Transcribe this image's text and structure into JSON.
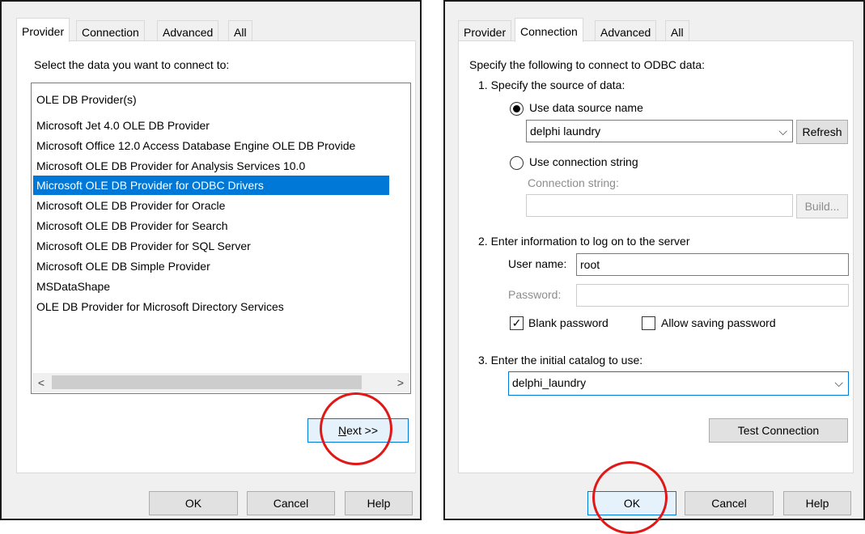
{
  "left_dialog": {
    "tabs": [
      "Provider",
      "Connection",
      "Advanced",
      "All"
    ],
    "instruction": "Select the data you want to connect to:",
    "list_header": "OLE DB Provider(s)",
    "providers": [
      "Microsoft Jet 4.0 OLE DB Provider",
      "Microsoft Office 12.0 Access Database Engine OLE DB Provide",
      "Microsoft OLE DB Provider for Analysis Services 10.0",
      "Microsoft OLE DB Provider for ODBC Drivers",
      "Microsoft OLE DB Provider for Oracle",
      "Microsoft OLE DB Provider for Search",
      "Microsoft OLE DB Provider for SQL Server",
      "Microsoft OLE DB Simple Provider",
      "MSDataShape",
      "OLE DB Provider for Microsoft Directory Services"
    ],
    "selected_index": 3,
    "scroll_left": "<",
    "scroll_right": ">",
    "next_label_hotkey": "N",
    "next_label_rest": "ext >>",
    "ok_label": "OK",
    "cancel_label": "Cancel",
    "help_label": "Help"
  },
  "right_dialog": {
    "tabs": [
      "Provider",
      "Connection",
      "Advanced",
      "All"
    ],
    "intro": "Specify the following to connect to ODBC data:",
    "step1": "1. Specify the source of data:",
    "radio_dsn_label": "Use data source name",
    "dsn_value": "delphi laundry",
    "refresh_label": "Refresh",
    "radio_connstr_label": "Use connection string",
    "connstr_label": "Connection string:",
    "connstr_value": "",
    "build_label": "Build...",
    "step2": "2. Enter information to log on to the server",
    "username_label": "User name:",
    "username_value": "root",
    "password_label": "Password:",
    "password_value": "",
    "blank_password_label": "Blank password",
    "blank_password_checked": true,
    "allow_saving_label": "Allow saving password",
    "allow_saving_checked": false,
    "step3": "3. Enter the initial catalog to use:",
    "catalog_value": "delphi_laundry",
    "test_connection_label": "Test Connection",
    "ok_label": "OK",
    "cancel_label": "Cancel",
    "help_label": "Help"
  },
  "icons": {
    "chevron": "⌵",
    "check": "✓"
  },
  "colors": {
    "selection": "#0078d7",
    "annotation_circle": "#e01818"
  }
}
